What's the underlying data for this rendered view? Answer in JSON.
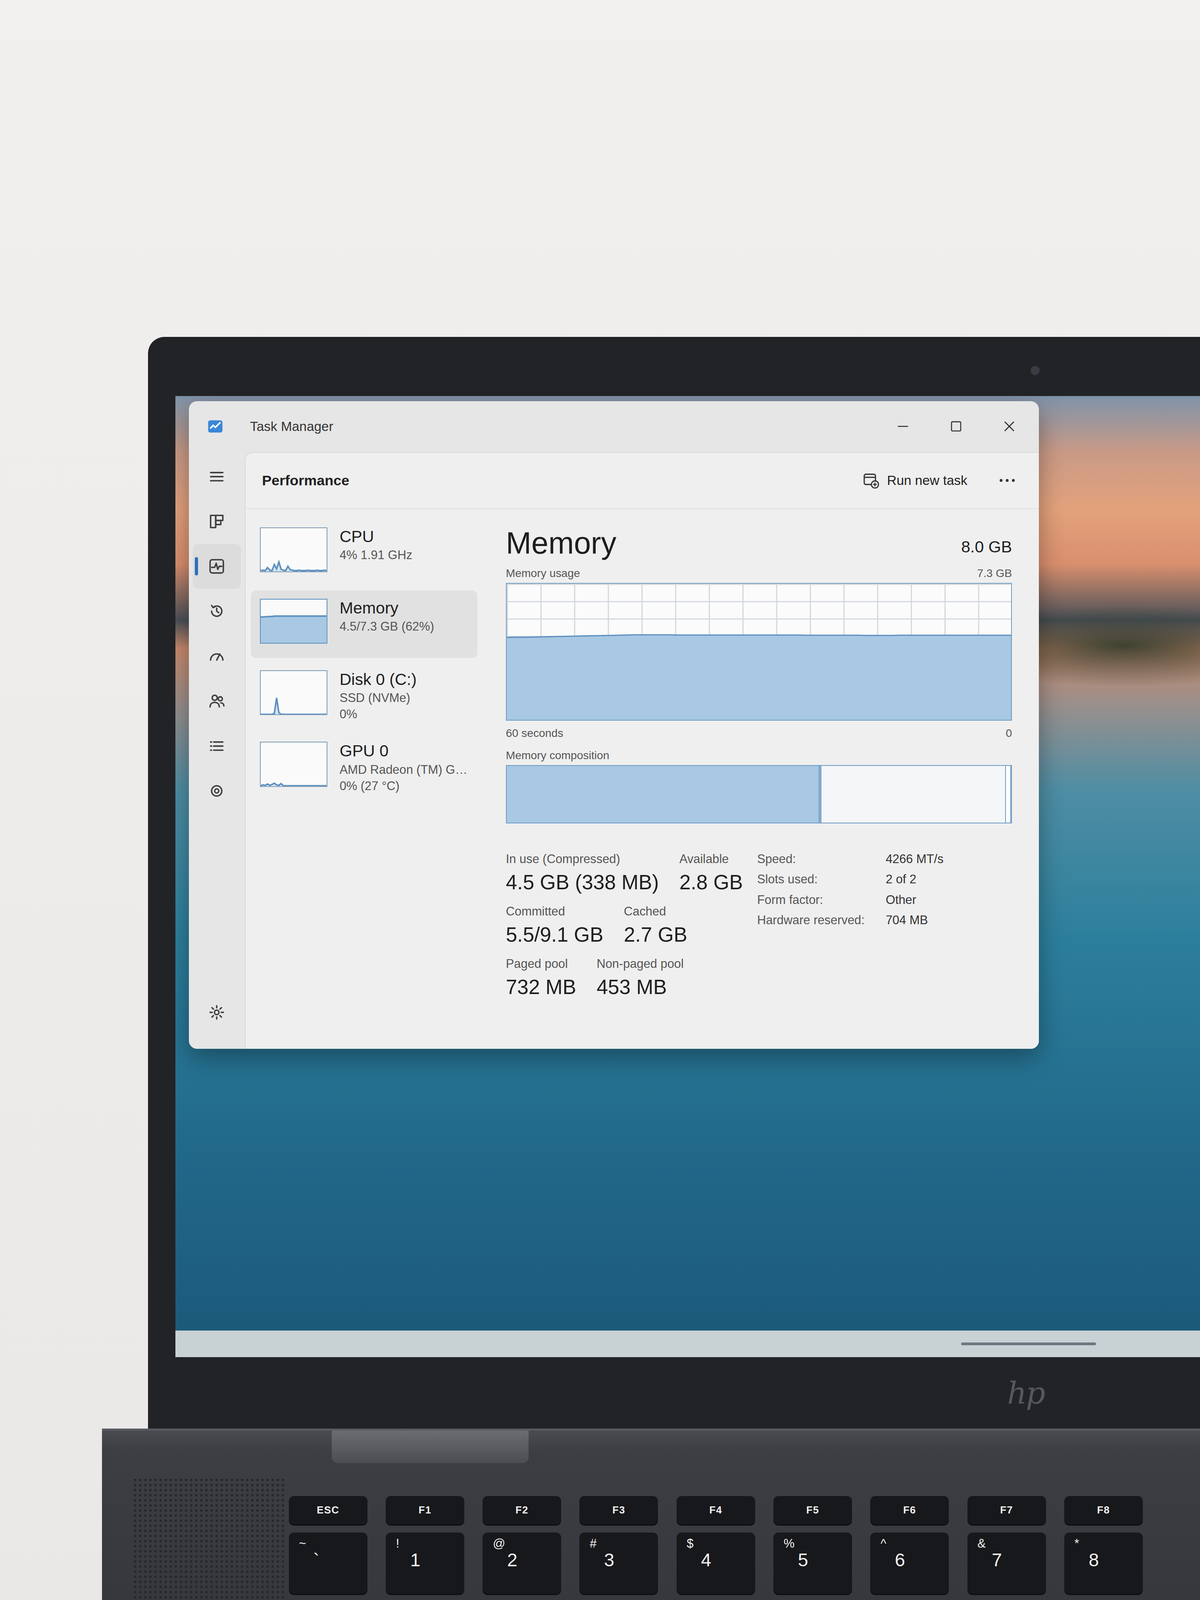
{
  "window": {
    "title": "Task Manager"
  },
  "nav": [
    {
      "kind": "menu",
      "selected": false
    },
    {
      "kind": "processes",
      "selected": false
    },
    {
      "kind": "performance",
      "selected": true
    },
    {
      "kind": "history",
      "selected": false
    },
    {
      "kind": "startup",
      "selected": false
    },
    {
      "kind": "users",
      "selected": false
    },
    {
      "kind": "details",
      "selected": false
    },
    {
      "kind": "services",
      "selected": false
    },
    {
      "kind": "settings",
      "selected": false
    }
  ],
  "header": {
    "title": "Performance",
    "action": "Run new task"
  },
  "resources": [
    {
      "name": "CPU",
      "lines": [
        "4% 1.91 GHz"
      ],
      "selected": false,
      "kind": "line",
      "series": [
        2,
        3,
        2,
        9,
        3,
        2,
        16,
        6,
        22,
        5,
        3,
        2,
        12,
        4,
        3,
        2,
        2,
        3,
        2,
        2,
        2,
        3,
        2,
        2,
        2,
        3,
        2,
        2,
        3,
        2
      ]
    },
    {
      "name": "Memory",
      "lines": [
        "4.5/7.3 GB (62%)"
      ],
      "selected": true,
      "kind": "area",
      "series": [
        60,
        60,
        61,
        61,
        62,
        62,
        62,
        62,
        62,
        62,
        62,
        62,
        62,
        62,
        62,
        62,
        62,
        62,
        62,
        62
      ]
    },
    {
      "name": "Disk 0 (C:)",
      "lines": [
        "SSD (NVMe)",
        "0%"
      ],
      "selected": false,
      "kind": "line",
      "series": [
        0,
        0,
        0,
        0,
        0,
        0,
        2,
        38,
        4,
        0,
        0,
        0,
        0,
        0,
        0,
        0,
        0,
        0,
        0,
        0,
        0,
        0,
        0,
        0,
        0,
        0,
        0,
        0,
        0,
        0
      ]
    },
    {
      "name": "GPU 0",
      "lines": [
        "AMD Radeon (TM) G…",
        "0% (27 °C)"
      ],
      "selected": false,
      "kind": "line",
      "series": [
        0,
        2,
        1,
        4,
        1,
        3,
        6,
        2,
        1,
        5,
        0,
        0,
        0,
        0,
        0,
        0,
        0,
        0,
        0,
        0,
        0,
        0,
        0,
        0,
        0,
        0,
        0,
        0,
        0,
        0
      ]
    }
  ],
  "memory": {
    "title": "Memory",
    "total": "8.0 GB",
    "usage_label": "Memory usage",
    "usage_max": "7.3 GB",
    "time_left": "60 seconds",
    "time_right": "0",
    "usage_series": [
      4.42,
      4.43,
      4.43,
      4.44,
      4.45,
      4.46,
      4.47,
      4.48,
      4.49,
      4.5,
      4.51,
      4.52,
      4.53,
      4.54,
      4.55,
      4.56,
      4.56,
      4.56,
      4.56,
      4.56,
      4.55,
      4.55,
      4.55,
      4.55,
      4.55,
      4.55,
      4.55,
      4.55,
      4.55,
      4.55,
      4.55,
      4.55,
      4.55,
      4.55,
      4.55,
      4.54,
      4.54,
      4.54,
      4.54,
      4.54,
      4.54,
      4.54,
      4.53,
      4.53,
      4.53,
      4.53,
      4.54,
      4.54,
      4.54,
      4.54,
      4.54,
      4.54,
      4.54,
      4.54,
      4.54,
      4.54,
      4.54,
      4.54,
      4.54,
      4.54
    ],
    "composition_label": "Memory composition",
    "composition": [
      {
        "part": "in-use",
        "level": 0.62
      },
      {
        "part": "modified",
        "level": 0.004
      },
      {
        "part": "standby",
        "level": 0.366
      },
      {
        "part": "free",
        "level": 0.01
      }
    ],
    "stats": [
      [
        {
          "label": "In use (Compressed)",
          "value": "4.5 GB (338 MB)"
        },
        {
          "label": "Available",
          "value": "2.8 GB"
        }
      ],
      [
        {
          "label": "Committed",
          "value": "5.5/9.1 GB"
        },
        {
          "label": "Cached",
          "value": "2.7 GB"
        }
      ],
      [
        {
          "label": "Paged pool",
          "value": "732 MB"
        },
        {
          "label": "Non-paged pool",
          "value": "453 MB"
        }
      ]
    ],
    "specs": [
      {
        "label": "Speed:",
        "value": "4266 MT/s"
      },
      {
        "label": "Slots used:",
        "value": "2 of 2"
      },
      {
        "label": "Form factor:",
        "value": "Other"
      },
      {
        "label": "Hardware reserved:",
        "value": "704 MB"
      }
    ]
  },
  "laptop": {
    "brand": "hp",
    "function_keys": [
      "ESC",
      "F1",
      "F2",
      "F3",
      "F4",
      "F5",
      "F6",
      "F7",
      "F8"
    ],
    "number_keys": [
      {
        "top": "~",
        "bottom": "`"
      },
      {
        "top": "!",
        "bottom": "1"
      },
      {
        "top": "@",
        "bottom": "2"
      },
      {
        "top": "#",
        "bottom": "3"
      },
      {
        "top": "$",
        "bottom": "4"
      },
      {
        "top": "%",
        "bottom": "5"
      },
      {
        "top": "^",
        "bottom": "6"
      },
      {
        "top": "&",
        "bottom": "7"
      },
      {
        "top": "*",
        "bottom": "8"
      }
    ]
  }
}
